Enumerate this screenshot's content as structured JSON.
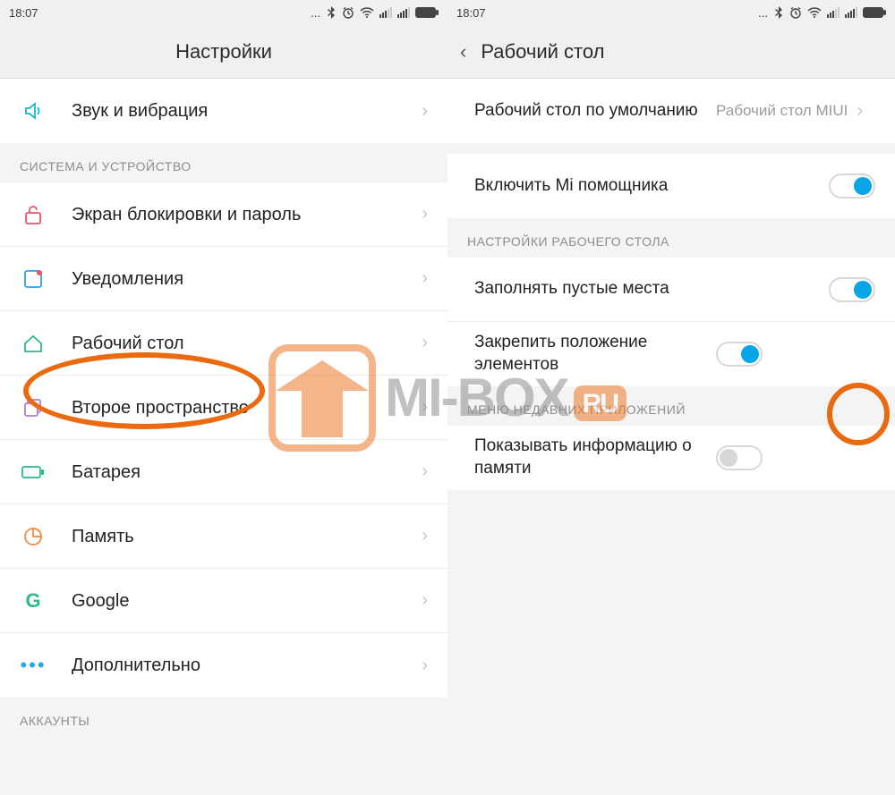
{
  "statusbar": {
    "time": "18:07"
  },
  "left": {
    "title": "Настройки",
    "row_sound": "Звук и вибрация",
    "section_system": "СИСТЕМА И УСТРОЙСТВО",
    "row_lock": "Экран блокировки и пароль",
    "row_notifications": "Уведомления",
    "row_launcher": "Рабочий стол",
    "row_second_space": "Второе пространство",
    "row_battery": "Батарея",
    "row_storage": "Память",
    "row_google": "Google",
    "row_more": "Дополнительно",
    "section_accounts": "АККАУНТЫ"
  },
  "right": {
    "title": "Рабочий стол",
    "row_default_launcher_label": "Рабочий стол по умолчанию",
    "row_default_launcher_value": "Рабочий стол MIUI",
    "row_mi_assistant": "Включить Mi помощника",
    "section_launcher_settings": "НАСТРОЙКИ РАБОЧЕГО СТОЛА",
    "row_fill_empty": "Заполнять пустые места",
    "row_lock_layout": "Закрепить положение элементов",
    "section_recents_menu": "МЕНЮ НЕДАВНИХ ПРИЛОЖЕНИЙ",
    "row_show_memory": "Показывать информацию о памяти"
  },
  "watermark": {
    "text": "MI-BOX",
    "badge": "RU"
  }
}
